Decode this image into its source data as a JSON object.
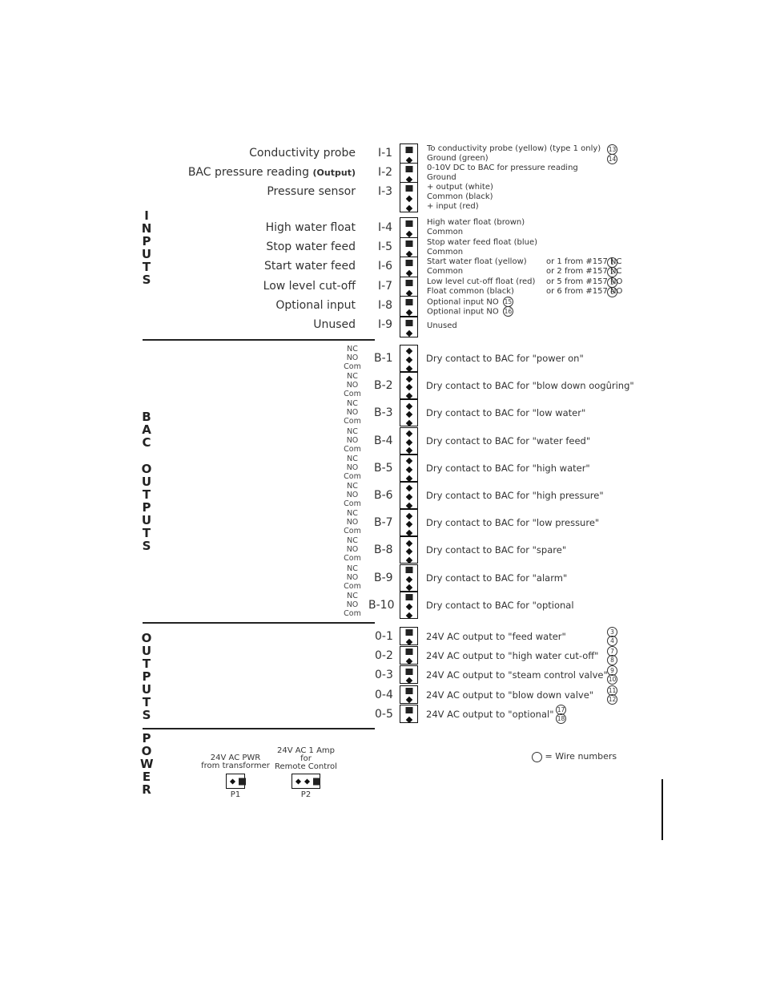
{
  "sections": {
    "inputs": "INPUTS",
    "bac_outputs": [
      "BAC",
      "OUTPUTS"
    ],
    "outputs": "OUTPUTS",
    "power": "POWER"
  },
  "inputs": [
    {
      "id": "I-1",
      "label": "Conductivity probe",
      "label_suffix": "",
      "pins": [
        "sq",
        "dot"
      ],
      "desc": [
        "To conductivity probe (yellow) (type 1 only)",
        "Ground (green)"
      ],
      "alt": [
        "",
        ""
      ],
      "wires": [
        "13",
        "14"
      ]
    },
    {
      "id": "I-2",
      "label": "BAC pressure reading",
      "label_suffix": "(Output)",
      "pins": [
        "sq",
        "dot"
      ],
      "desc": [
        "0-10V DC to BAC for pressure reading",
        "Ground"
      ],
      "alt": [
        "",
        ""
      ],
      "wires": [
        "",
        ""
      ]
    },
    {
      "id": "I-3",
      "label": "Pressure sensor",
      "label_suffix": "",
      "pins": [
        "sq",
        "dot",
        "dot"
      ],
      "desc": [
        "+ output (white)",
        "Common (black)",
        "+ input (red)"
      ],
      "alt": [
        "",
        "",
        ""
      ],
      "wires": [
        "",
        "",
        ""
      ]
    },
    {
      "id": "I-4",
      "label": "High water float",
      "label_suffix": "",
      "pins": [
        "sq",
        "dot"
      ],
      "desc": [
        "High water float (brown)",
        "Common"
      ],
      "alt": [
        "",
        ""
      ],
      "wires": [
        "",
        ""
      ]
    },
    {
      "id": "I-5",
      "label": "Stop water feed",
      "label_suffix": "",
      "pins": [
        "sq",
        "dot"
      ],
      "desc": [
        "Stop water feed float (blue)",
        "Common"
      ],
      "alt": [
        "",
        ""
      ],
      "wires": [
        "",
        ""
      ]
    },
    {
      "id": "I-6",
      "label": "Start water feed",
      "label_suffix": "",
      "pins": [
        "sq",
        "dot"
      ],
      "desc": [
        "Start water float (yellow)",
        "Common"
      ],
      "alt": [
        "or 1 from #157 NC",
        "or 2 from #157 NC"
      ],
      "wires": [
        "1",
        "2"
      ]
    },
    {
      "id": "I-7",
      "label": "Low level cut-off",
      "label_suffix": "",
      "pins": [
        "sq",
        "dot"
      ],
      "desc": [
        "Low level cut-off float (red)",
        "Float common (black)"
      ],
      "alt": [
        "or 5 from #157 NO",
        "or 6 from #157 NO"
      ],
      "wires": [
        "5",
        "6"
      ]
    },
    {
      "id": "I-8",
      "label": "Optional input",
      "label_suffix": "",
      "pins": [
        "sq",
        "dot"
      ],
      "desc": [
        "Optional input NO",
        "Optional input NO"
      ],
      "alt": [
        "",
        ""
      ],
      "inline_wires": [
        "15",
        "16"
      ]
    },
    {
      "id": "I-9",
      "label": "Unused",
      "label_suffix": "",
      "pins": [
        "sq",
        "dot"
      ],
      "desc": [
        "Unused"
      ],
      "alt": [
        ""
      ],
      "wires": [
        ""
      ]
    }
  ],
  "bac_pin_labels": [
    "NC",
    "NO",
    "Com"
  ],
  "bac_outputs": [
    {
      "id": "B-1",
      "desc": "Dry contact to BAC for \"power on\"",
      "pins": [
        "dot",
        "dot",
        "dot"
      ]
    },
    {
      "id": "B-2",
      "desc": "Dry contact to BAC for \"blow down oogûring\"",
      "pins": [
        "dot",
        "dot",
        "dot"
      ]
    },
    {
      "id": "B-3",
      "desc": "Dry contact to BAC for \"low water\"",
      "pins": [
        "dot",
        "dot",
        "dot"
      ]
    },
    {
      "id": "B-4",
      "desc": "Dry contact to BAC for \"water feed\"",
      "pins": [
        "dot",
        "dot",
        "dot"
      ]
    },
    {
      "id": "B-5",
      "desc": "Dry contact to BAC for \"high water\"",
      "pins": [
        "dot",
        "dot",
        "dot"
      ]
    },
    {
      "id": "B-6",
      "desc": "Dry contact to BAC for \"high pressure\"",
      "pins": [
        "dot",
        "dot",
        "dot"
      ]
    },
    {
      "id": "B-7",
      "desc": "Dry contact to BAC for \"low pressure\"",
      "pins": [
        "dot",
        "dot",
        "dot"
      ]
    },
    {
      "id": "B-8",
      "desc": "Dry contact to BAC for \"spare\"",
      "pins": [
        "dot",
        "dot",
        "dot"
      ]
    },
    {
      "id": "B-9",
      "desc": "Dry contact to BAC for \"alarm\"",
      "pins": [
        "sq",
        "dot",
        "dot"
      ]
    },
    {
      "id": "B-10",
      "desc": "Dry contact to BAC for \"optional",
      "pins": [
        "sq",
        "dot",
        "dot"
      ]
    }
  ],
  "outputs": [
    {
      "id": "0-1",
      "desc": "24V AC output to \"feed water\"",
      "wires": [
        "3",
        "4"
      ]
    },
    {
      "id": "0-2",
      "desc": "24V AC output to \"high water cut-off\"",
      "wires": [
        "7",
        "8"
      ]
    },
    {
      "id": "0-3",
      "desc": "24V AC output to \"steam control valve\"",
      "wires": [
        "9",
        "10"
      ]
    },
    {
      "id": "0-4",
      "desc": "24V AC output to \"blow down valve\"",
      "wires": [
        "11",
        "12"
      ]
    },
    {
      "id": "0-5",
      "desc": "24V AC output to \"optional\"",
      "wires": [
        "17",
        "18"
      ]
    }
  ],
  "power": [
    {
      "id": "P1",
      "label": [
        "24V AC PWR",
        "from transformer"
      ],
      "pins": [
        "dot",
        "sq"
      ]
    },
    {
      "id": "P2",
      "label": [
        "24V AC 1 Amp",
        "for",
        "Remote Control"
      ],
      "pins": [
        "dot",
        "dot",
        "sq"
      ]
    }
  ],
  "legend": {
    "text": "= Wire numbers"
  }
}
